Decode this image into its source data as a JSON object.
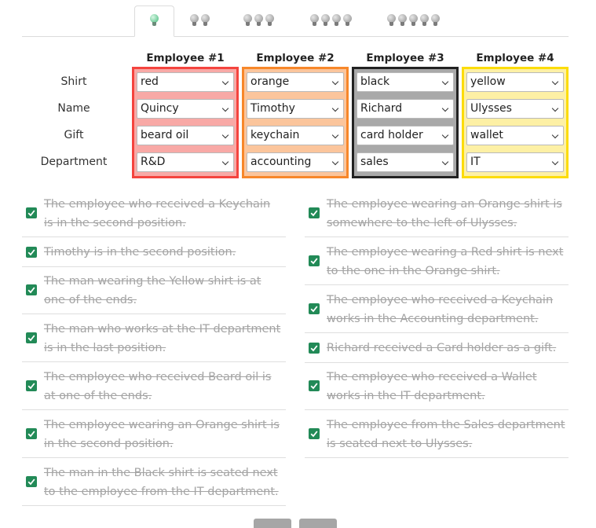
{
  "tabs": [
    {
      "bulbs": 1,
      "active": true
    },
    {
      "bulbs": 2,
      "active": false
    },
    {
      "bulbs": 3,
      "active": false
    },
    {
      "bulbs": 4,
      "active": false
    },
    {
      "bulbs": 5,
      "active": false
    }
  ],
  "row_labels": [
    "Shirt",
    "Name",
    "Gift",
    "Department"
  ],
  "employees": [
    {
      "header": "Employee #1",
      "color": "#f4443e",
      "light": "#f8a9a6",
      "values": [
        "red",
        "Quincy",
        "beard oil",
        "R&D"
      ]
    },
    {
      "header": "Employee #2",
      "color": "#f7872a",
      "light": "#fbc59c",
      "values": [
        "orange",
        "Timothy",
        "keychain",
        "accounting"
      ]
    },
    {
      "header": "Employee #3",
      "color": "#222222",
      "light": "#a9a9a9",
      "values": [
        "black",
        "Richard",
        "card holder",
        "sales"
      ]
    },
    {
      "header": "Employee #4",
      "color": "#fcdc0a",
      "light": "#fdf0a5",
      "values": [
        "yellow",
        "Ulysses",
        "wallet",
        "IT"
      ]
    }
  ],
  "clues_left": [
    {
      "text": "The employee who received a Keychain is in the second position."
    },
    {
      "text": "Timothy is in the second position."
    },
    {
      "text": "The man wearing the Yellow shirt is at one of the ends."
    },
    {
      "text": "The man who works at the IT department is in the last position."
    },
    {
      "text": "The employee who received Beard oil is at one of the ends."
    },
    {
      "text": "The employee wearing an Orange shirt is in the second position."
    },
    {
      "text": "The man in the Black shirt is seated next to the employee from the IT department."
    }
  ],
  "clues_right": [
    {
      "text": "The employee wearing an Orange shirt is somewhere to the left of Ulysses."
    },
    {
      "text": "The employee wearing a Red shirt is next to the one in the Orange shirt."
    },
    {
      "text": "The employee who received a Keychain works in the Accounting department."
    },
    {
      "text": "Richard received a Card holder as a gift."
    },
    {
      "text": "The employee who received a Wallet works in the IT department."
    },
    {
      "text": "The employee from the Sales department is seated next to Ulysses."
    }
  ],
  "colors": {
    "check": "#228a57",
    "active_bulb": "#43b97a"
  }
}
